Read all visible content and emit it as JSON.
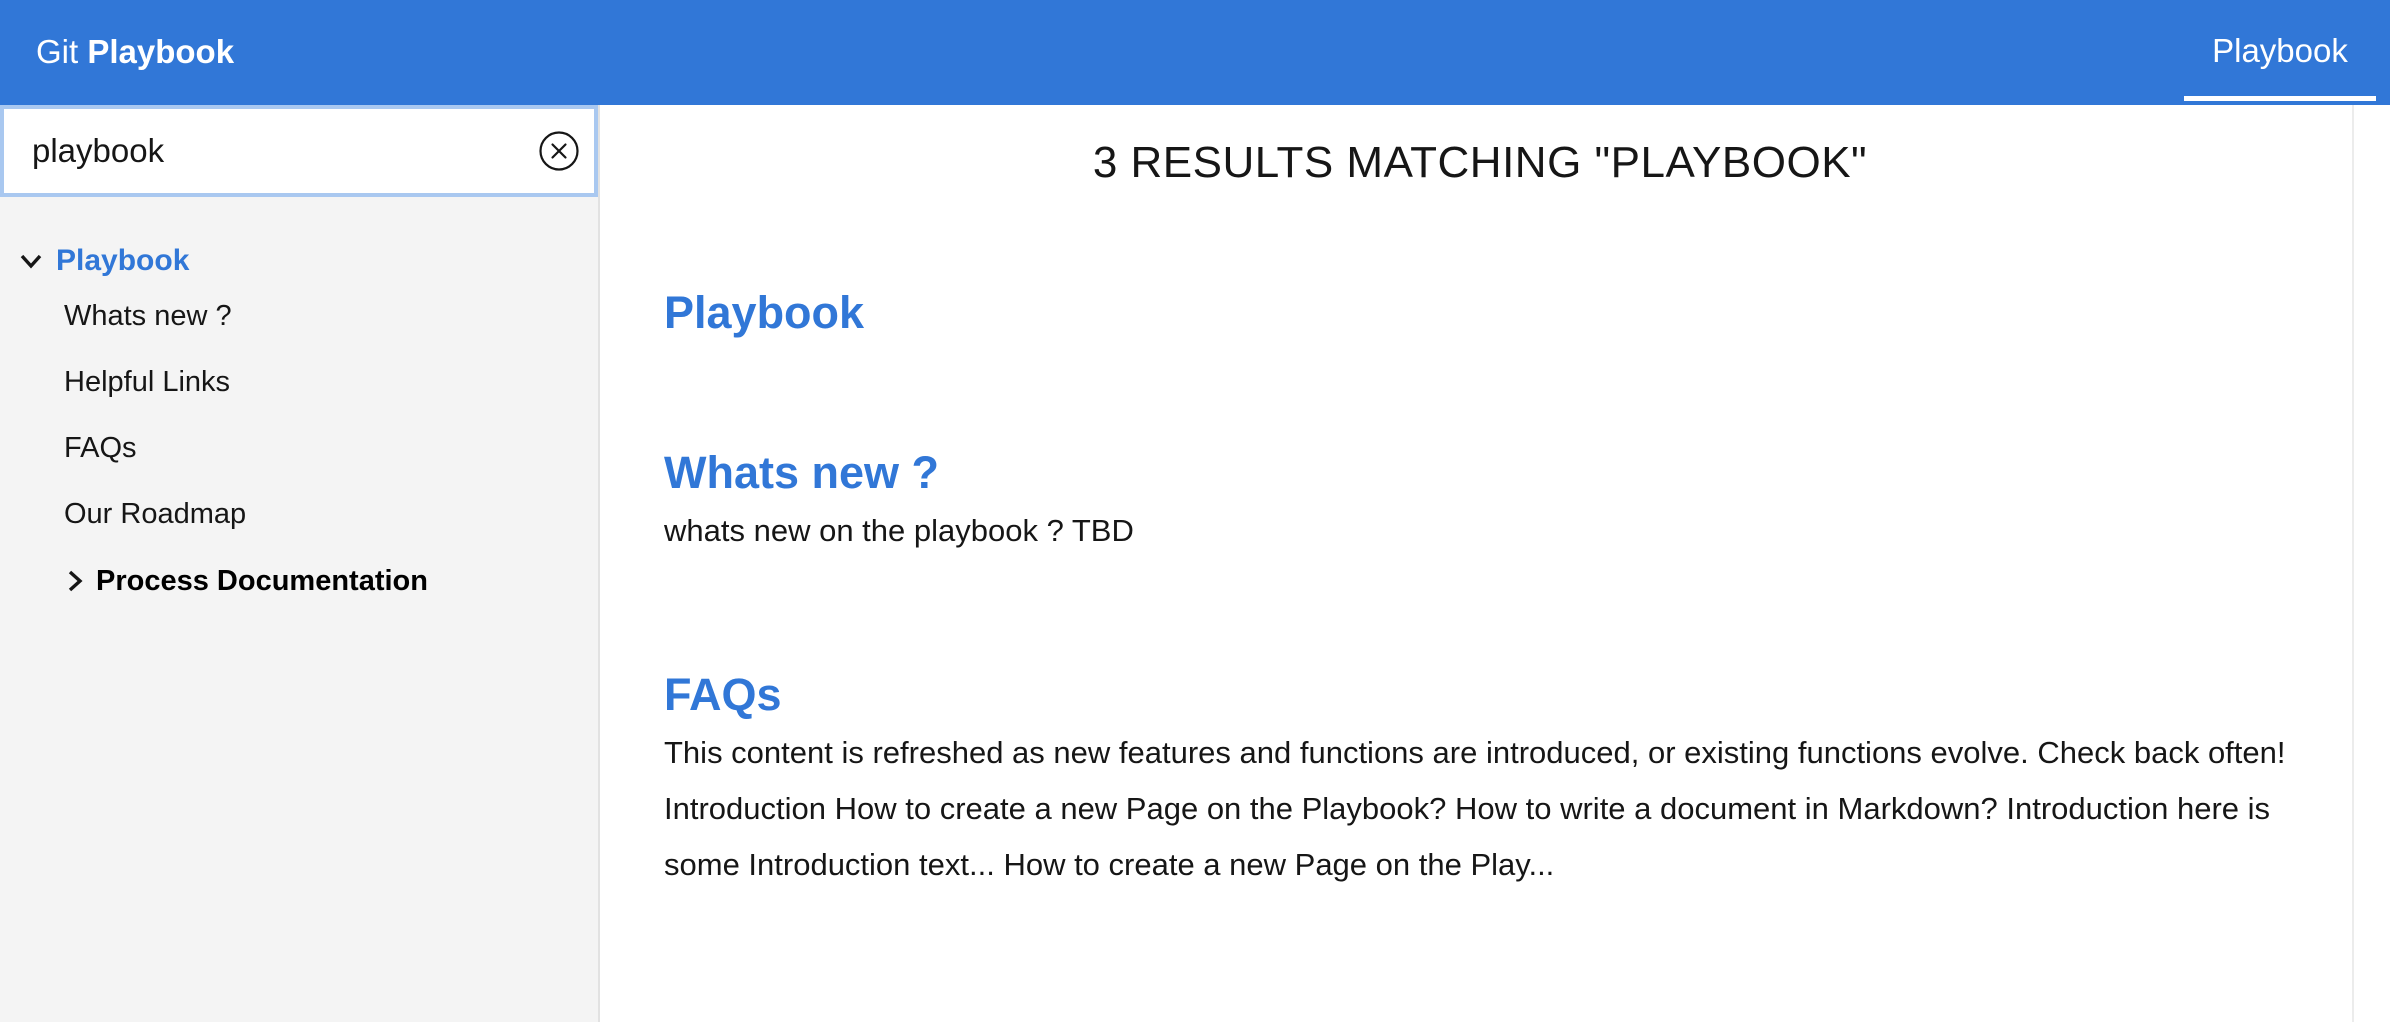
{
  "header": {
    "brand_prefix": "Git",
    "brand_name": "Playbook",
    "nav_tab": "Playbook"
  },
  "search": {
    "value": "playbook",
    "placeholder": "Search"
  },
  "sidebar": {
    "root_label": "Playbook",
    "items": [
      {
        "label": "Whats new ?"
      },
      {
        "label": "Helpful Links"
      },
      {
        "label": "FAQs"
      },
      {
        "label": "Our Roadmap"
      }
    ],
    "group_label": "Process Documentation"
  },
  "results": {
    "heading": "3 RESULTS MATCHING \"PLAYBOOK\"",
    "items": [
      {
        "title": "Playbook",
        "snippet": ""
      },
      {
        "title": "Whats new ?",
        "snippet": "whats new on the playbook ? TBD"
      },
      {
        "title": "FAQs",
        "snippet": "This content is refreshed as new features and functions are introduced, or existing functions evolve. Check back often! Introduction How to create a new Page on the Playbook? How to write a document in Markdown? Introduction here is some Introduction text... How to create a new Page on the Play..."
      }
    ]
  },
  "colors": {
    "header_bg": "#3177d7",
    "accent": "#3177d7",
    "sidebar_bg": "#f4f4f4"
  },
  "icons": {
    "clear": "close-circle-icon",
    "expanded": "chevron-down-icon",
    "collapsed": "chevron-right-icon"
  }
}
